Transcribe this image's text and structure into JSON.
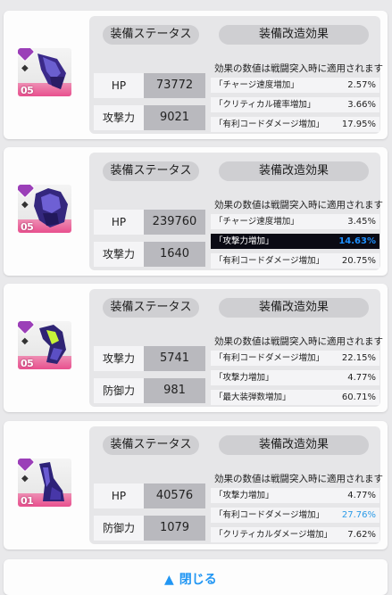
{
  "note_text": "効果の数値は戦闘突入時に適用されます",
  "status_header": "装備ステータス",
  "effect_header": "装備改造効果",
  "close_label": "閉じる",
  "cards": [
    {
      "level": "05",
      "stats": [
        {
          "label": "HP",
          "value": "73772"
        },
        {
          "label": "攻撃力",
          "value": "9021"
        }
      ],
      "effects": [
        {
          "name": "「チャージ速度増加」",
          "value": "2.57%"
        },
        {
          "name": "「クリティカル確率増加」",
          "value": "3.66%"
        },
        {
          "name": "「有利コードダメージ増加」",
          "value": "17.95%"
        }
      ]
    },
    {
      "level": "05",
      "stats": [
        {
          "label": "HP",
          "value": "239760"
        },
        {
          "label": "攻撃力",
          "value": "1640"
        }
      ],
      "effects": [
        {
          "name": "「チャージ速度増加」",
          "value": "3.45%"
        },
        {
          "name": "「攻撃力増加」",
          "value": "14.63%"
        },
        {
          "name": "「有利コードダメージ増加」",
          "value": "20.75%"
        }
      ]
    },
    {
      "level": "05",
      "stats": [
        {
          "label": "攻撃力",
          "value": "5741"
        },
        {
          "label": "防御力",
          "value": "981"
        }
      ],
      "effects": [
        {
          "name": "「有利コードダメージ増加」",
          "value": "22.15%"
        },
        {
          "name": "「攻撃力増加」",
          "value": "4.77%"
        },
        {
          "name": "「最大装弾数増加」",
          "value": "60.71%"
        }
      ]
    },
    {
      "level": "01",
      "stats": [
        {
          "label": "HP",
          "value": "40576"
        },
        {
          "label": "防御力",
          "value": "1079"
        }
      ],
      "effects": [
        {
          "name": "「攻撃力増加」",
          "value": "4.77%"
        },
        {
          "name": "「有利コードダメージ増加」",
          "value": "27.76%"
        },
        {
          "name": "「クリティカルダメージ増加」",
          "value": "7.62%"
        }
      ]
    }
  ]
}
